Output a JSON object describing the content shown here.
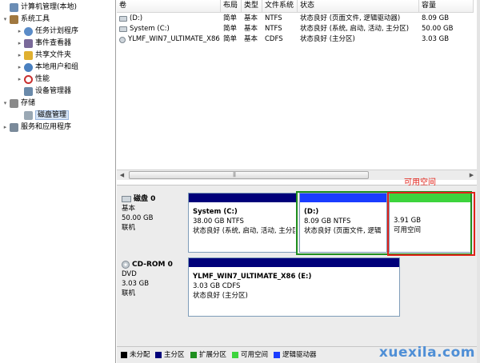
{
  "tree": [
    {
      "label": "计算机管理(本地)",
      "arrow": "",
      "icon": "computer-icon",
      "color": "#6b8db5",
      "level": 0
    },
    {
      "label": "系统工具",
      "arrow": "▾",
      "icon": "tools-icon",
      "color": "#a07840",
      "level": 1
    },
    {
      "label": "任务计划程序",
      "arrow": "▸",
      "icon": "clock-icon",
      "color": "#5b8cc8",
      "level": 2
    },
    {
      "label": "事件查看器",
      "arrow": "▸",
      "icon": "event-viewer-icon",
      "color": "#7a6a9a",
      "level": 2
    },
    {
      "label": "共享文件夹",
      "arrow": "▸",
      "icon": "shared-folder-icon",
      "color": "#e0b030",
      "level": 2
    },
    {
      "label": "本地用户和组",
      "arrow": "▸",
      "icon": "users-icon",
      "color": "#4a80c0",
      "level": 2
    },
    {
      "label": "性能",
      "arrow": "▸",
      "icon": "performance-icon",
      "color": "#c83030",
      "level": 2
    },
    {
      "label": "设备管理器",
      "arrow": "",
      "icon": "device-manager-icon",
      "color": "#6a8aaa",
      "level": 2
    },
    {
      "label": "存储",
      "arrow": "▾",
      "icon": "storage-icon",
      "color": "#8a8a8a",
      "level": 1
    },
    {
      "label": "磁盘管理",
      "arrow": "",
      "icon": "disk-management-icon",
      "color": "#9aa8b4",
      "level": 2,
      "selected": true
    },
    {
      "label": "服务和应用程序",
      "arrow": "▸",
      "icon": "services-icon",
      "color": "#7a8a9a",
      "level": 1
    }
  ],
  "list": {
    "columns": [
      "卷",
      "布局",
      "类型",
      "文件系统",
      "状态",
      "容量"
    ],
    "rows": [
      [
        "(D:)",
        "简单",
        "基本",
        "NTFS",
        "状态良好 (页面文件, 逻辑驱动器)",
        "8.09 GB"
      ],
      [
        "System (C:)",
        "简单",
        "基本",
        "NTFS",
        "状态良好 (系统, 启动, 活动, 主分区)",
        "50.00 GB"
      ],
      [
        "YLMF_WIN7_ULTIMATE_X86 (E:)",
        "简单",
        "基本",
        "CDFS",
        "状态良好 (主分区)",
        "3.03 GB"
      ]
    ]
  },
  "disks": [
    {
      "name": "磁盘 0",
      "type": "基本",
      "size": "50.00 GB",
      "status": "联机"
    },
    {
      "name": "CD-ROM 0",
      "type": "DVD",
      "size": "3.03 GB",
      "status": "联机"
    }
  ],
  "partitions": {
    "system": {
      "name": "System  (C:)",
      "size": "38.00 GB NTFS",
      "status": "状态良好 (系统, 启动, 活动, 主分区"
    },
    "d": {
      "name": "(D:)",
      "size": "8.09 GB NTFS",
      "status": "状态良好 (页面文件, 逻辑"
    },
    "free": {
      "size": "3.91 GB",
      "status": "可用空间"
    },
    "cd": {
      "name": "YLMF_WIN7_ULTIMATE_X86  (E:)",
      "size": "3.03 GB CDFS",
      "status": "状态良好 (主分区)"
    }
  },
  "annotation": "可用空间",
  "legend": [
    {
      "label": "未分配",
      "color": "#000000"
    },
    {
      "label": "主分区",
      "color": "#00007a"
    },
    {
      "label": "扩展分区",
      "color": "#1f8f1f"
    },
    {
      "label": "可用空间",
      "color": "#3dd43d"
    },
    {
      "label": "逻辑驱动器",
      "color": "#1a3cff"
    }
  ],
  "watermark": "xuexila.com",
  "colors": {
    "primary_bar": "#00007a",
    "logical_bar": "#1a3cff",
    "free_bar": "#3dd43d",
    "highlight_red": "#e2231a",
    "highlight_green": "#1f8f1f"
  }
}
